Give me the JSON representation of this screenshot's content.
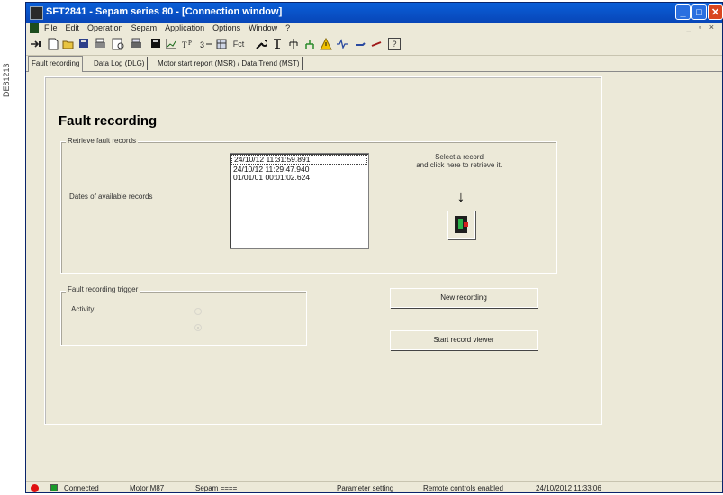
{
  "side_label": "DE81213",
  "window": {
    "title": "SFT2841 - Sepam series 80 - [Connection window]",
    "buttons": {
      "minimize": "_",
      "maximize": "□",
      "close": "✕"
    },
    "mdi_controls": "_ ▫ ×"
  },
  "menu": [
    "File",
    "Edit",
    "Operation",
    "Sepam",
    "Application",
    "Options",
    "Window",
    "?"
  ],
  "toolbar": {
    "icons": [
      "connect-icon",
      "new-icon",
      "open-icon",
      "save-icon",
      "print-icon",
      "print-preview-icon",
      "print-setup-icon",
      "save-all-icon",
      "chart-icon",
      "text-icon",
      "copy-icon",
      "settings-icon",
      "fct-button",
      "wrench-icon",
      "tool-icon",
      "circuit-icon",
      "network-icon",
      "alarm-icon",
      "signal-icon",
      "flag-icon",
      "arrow-icon",
      "help-icon"
    ],
    "fct_label": "Fct",
    "help_label": "?"
  },
  "tabs": [
    "Fault recording",
    "Data Log (DLG)",
    "Motor start report (MSR) / Data Trend (MST)"
  ],
  "page": {
    "title": "Fault recording",
    "retrieve_group": "Retrieve fault records",
    "dates_label": "Dates of available records",
    "records": [
      "24/10/12   11:31:59.891",
      "24/10/12   11:29:47.940",
      "01/01/01   00:01:02.624"
    ],
    "select_hint_line1": "Select a record",
    "select_hint_line2": "and click here to retrieve it.",
    "arrow": "↓",
    "trigger_group": "Fault recording trigger",
    "activity_label": "Activity",
    "new_recording": "New recording",
    "start_viewer": "Start record viewer"
  },
  "status": {
    "connection": "Connected",
    "motor": "Motor M87",
    "sepam": "Sepam ====",
    "mode": "Parameter setting",
    "remote": "Remote controls enabled",
    "datetime": "24/10/2012 11:33:06"
  },
  "colors": {
    "title_bar": "#0a5fd8",
    "window_bg": "#ece9d8",
    "led_connected": "#e01010",
    "led_ok": "#1a9a2a"
  }
}
